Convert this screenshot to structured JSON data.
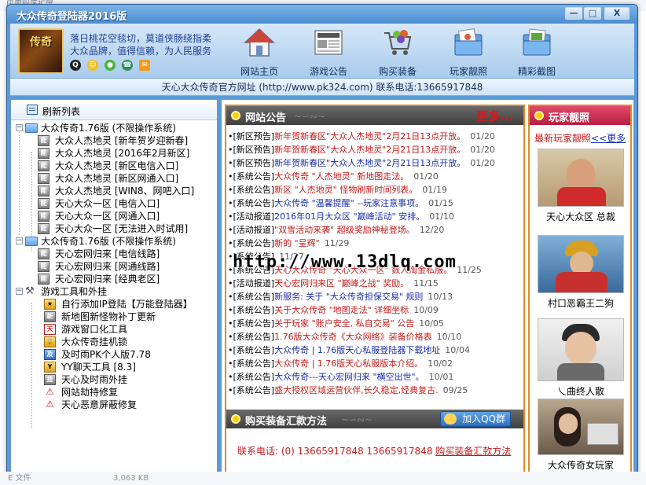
{
  "desktop": {
    "top_text": "应用程序扩展",
    "bottom_type": "E 文件",
    "bottom_size": "3,063 KB"
  },
  "window": {
    "title": "大众传奇登陆器2016版",
    "buttons": {
      "minimize": "—",
      "maximize": "□",
      "close": "X"
    }
  },
  "header": {
    "logo_text": "传奇",
    "slogan_line1": "落日桃花空毯切，莫道侠肠绕指柔",
    "slogan_line2": "大众品牌，值得信赖，为人民服务",
    "nav": [
      {
        "label": "网站主页",
        "icon": "house-icon"
      },
      {
        "label": "游戏公告",
        "icon": "newspaper-icon"
      },
      {
        "label": "购买装备",
        "icon": "shopping-cart-icon"
      },
      {
        "label": "玩家靓照",
        "icon": "photo-folder-icon"
      },
      {
        "label": "精彩截图",
        "icon": "screenshot-folder-icon"
      }
    ]
  },
  "infobar": {
    "text": "天心大众传奇官方网址 (http://www.pk324.com) 联系电话:13665917848"
  },
  "sidebar": {
    "refresh_label": "刷新列表",
    "groups": [
      {
        "label": "大众传奇1.76版 (不限操作系统)",
        "items": [
          "大众人杰地灵 [新年贺岁迎新春]",
          "大众人杰地灵 [2016年2月新区]",
          "大众人杰地灵 [新区电信入口]",
          "大众人杰地灵 [新区网通入口]",
          "大众人杰地灵 [WIN8、网吧入口]",
          "天心大众一区 [电信入口]",
          "天心大众一区 [网通入口]",
          "天心大众一区 [无法进入时试用]"
        ]
      },
      {
        "label": "大众传奇1.76版 (不限操作系统)",
        "items": [
          "天心宏网归来 [电信线路]",
          "天心宏网归来 [网通线路]",
          "天心宏网归来 [经典老区]"
        ]
      },
      {
        "label": "游戏工具和外挂",
        "items": [
          "自行添加IP登陆【万能登陆器】",
          "新地图新怪物补丁更新",
          "游戏窗口化工具",
          "大众传奇挂机锁",
          "及时雨PK个人版7.78",
          "YY聊天工具 [8.3]",
          "天心及时雨外挂",
          "网站劫持修复",
          "天心恶意屏蔽修复"
        ]
      }
    ]
  },
  "news": {
    "title": "网站公告",
    "more": "更多...",
    "items": [
      {
        "cat": "[新区预告]",
        "title": "新年贺新春区\"大众人杰地灵\"2月21日13点开放。",
        "date": "01/20",
        "color": "red"
      },
      {
        "cat": "[新区预告]",
        "title": "新年贺新春区\"大众人杰地灵\"2月21日13点开放。",
        "date": "01/20",
        "color": "red"
      },
      {
        "cat": "[新区预告]",
        "title": "新年贺新春区\"大众人杰地灵\"2月21日13点开放。",
        "date": "01/20",
        "color": "blue"
      },
      {
        "cat": "[系统公告]",
        "title": "大众传奇 \"人杰地灵\" 新地图走法。",
        "date": "01/20",
        "color": "red"
      },
      {
        "cat": "[系统公告]",
        "title": "新区 \"人杰地灵\" 怪物刷新时间列表。",
        "date": "01/19",
        "color": "red"
      },
      {
        "cat": "[系统公告]",
        "title": "大众传奇 \"温馨提醒\" --玩家注意事项。",
        "date": "01/15",
        "color": "blue"
      },
      {
        "cat": "[活动报道]",
        "title": "2016年01月大众区 \"巅峰活动\" 安排。",
        "date": "01/10",
        "color": "blue"
      },
      {
        "cat": "[活动报道]",
        "title": "\"双雪活动来袭\" 超级奖励神秘登场。",
        "date": "12/20",
        "color": "red"
      },
      {
        "cat": "[系统公告]",
        "title": "新的 \"呈辉\"",
        "date": "11/29",
        "color": "red"
      },
      {
        "cat": "[系统公告]",
        "title": "",
        "date": "11/27",
        "color": "red"
      },
      {
        "cat": "[系统公告]",
        "title": "天心大众传奇 \"天心大众一区\" 数人淘金私服。",
        "date": "11/25",
        "color": "red"
      },
      {
        "cat": "[活动报道]",
        "title": "天心宏网归来区 \"巅峰之战\" 奖励。",
        "date": "11/15",
        "color": "red"
      },
      {
        "cat": "[系统公告]",
        "title": "新服务: 关于 \"大众传奇担保交易\" 规则",
        "date": "10/13",
        "color": "blue"
      },
      {
        "cat": "[系统公告]",
        "title": "关于大众传奇 \"地图走法\" 详细坐标",
        "date": "10/09",
        "color": "red"
      },
      {
        "cat": "[系统公告]",
        "title": "关于玩家 \"账户安全, 私自交易\" 公告",
        "date": "10/05",
        "color": "red"
      },
      {
        "cat": "[系统公告]",
        "title": "1.76版大众传奇《大众网络》装备价格表",
        "date": "10/10",
        "color": "red"
      },
      {
        "cat": "[系统公告]",
        "title": "大众传奇 | 1.76版天心私服登陆器下载地址",
        "date": "10/04",
        "color": "blue"
      },
      {
        "cat": "[系统公告]",
        "title": "大众传奇 | 1.76版天心私服版本介绍。",
        "date": "10/02",
        "color": "red"
      },
      {
        "cat": "[系统公告]",
        "title": "大众传奇---天心宏网归来 \"横空出世\"。",
        "date": "10/01",
        "color": "blue"
      },
      {
        "cat": "[系统公告]",
        "title": "盛大授权区域运营伙伴,长久稳定,经典复古.",
        "date": "09/25",
        "color": "red"
      }
    ],
    "watermark": "http://www.13dlq.com"
  },
  "payment": {
    "title": "购买装备汇款方法",
    "qq_button": "加入QQ群",
    "phone_text": "联系电话: (0) 13665917848 13665917848",
    "link": "购买装备汇款方法"
  },
  "players": {
    "title": "玩家靓照",
    "latest_label": "最新玩家靓照",
    "latest_more": "<<更多",
    "photos": [
      {
        "caption": "天心大众区 总裁"
      },
      {
        "caption": "村口恶霸王二狗"
      },
      {
        "caption": "乀曲终人散"
      },
      {
        "caption": "大众传奇女玩家"
      }
    ]
  }
}
